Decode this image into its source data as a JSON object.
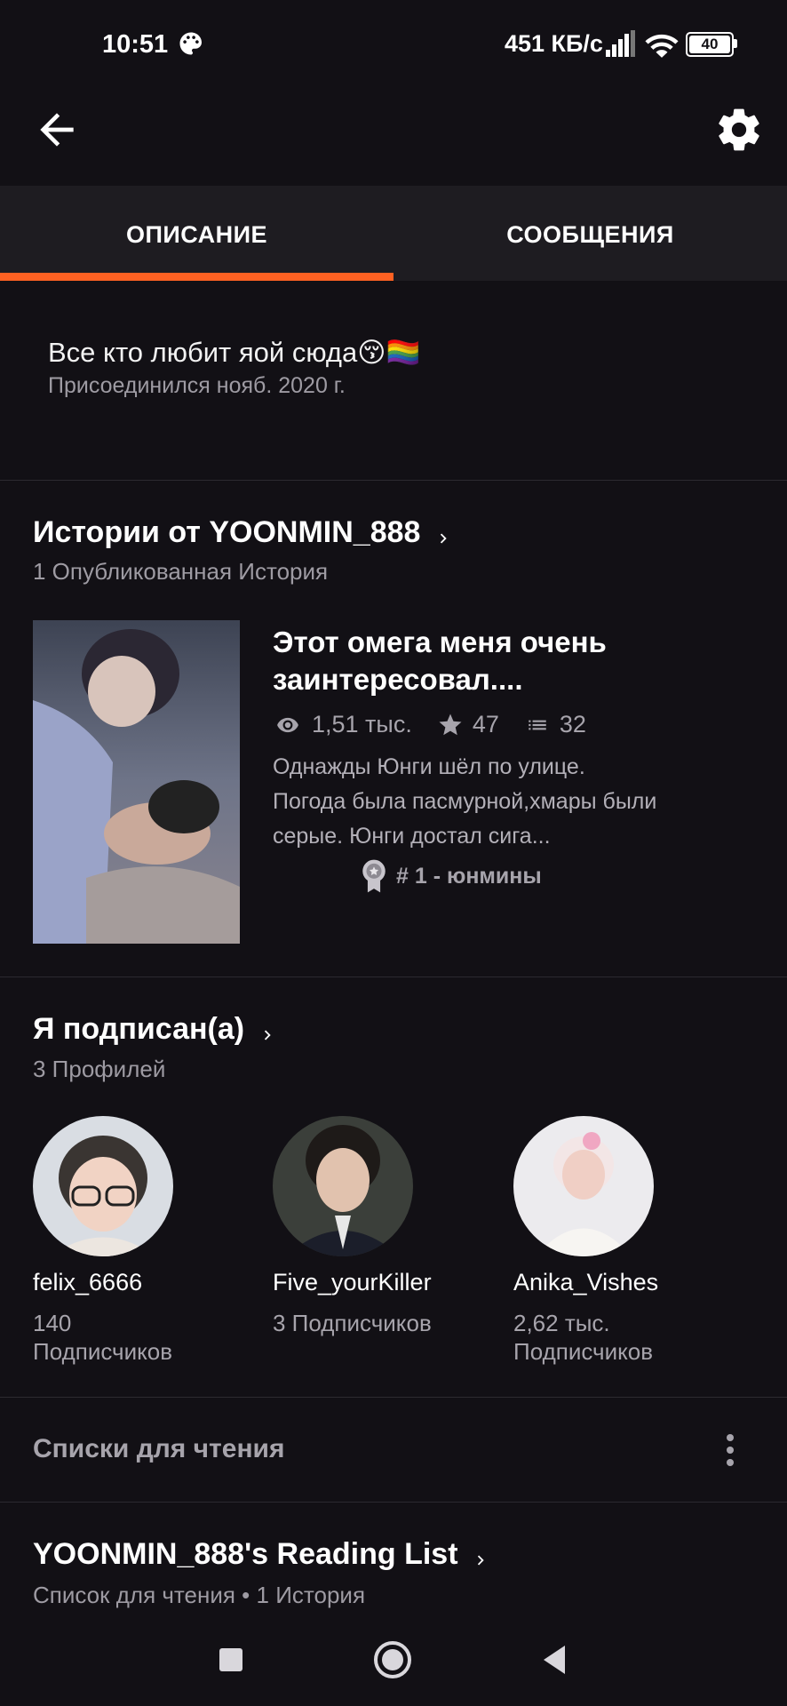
{
  "status_bar": {
    "time": "10:51",
    "net_speed": "451 КБ/с",
    "battery": "40"
  },
  "tabs": [
    {
      "label": "ОПИСАНИЕ",
      "active": true
    },
    {
      "label": "СООБЩЕНИЯ",
      "active": false
    }
  ],
  "accent_color": "#ff6122",
  "description": {
    "text": "Все кто любит яой сюда😚🏳️‍🌈",
    "joined": "Присоединился нояб. 2020 г."
  },
  "stories": {
    "title": "Истории от YOONMIN_888",
    "subtitle": "1 Опубликованная История",
    "items": [
      {
        "title": "Этот омега меня очень заинтересовал....",
        "reads": "1,51 тыс.",
        "votes": "47",
        "parts": "32",
        "blurb": "Однажды Юнги шёл по улице. Погода была пасмурной,хмары были серые. Юнги достал сига...",
        "badge": "# 1 - юнмины"
      }
    ]
  },
  "following": {
    "title": "Я подписан(а)",
    "subtitle": "3 Профилей",
    "profiles": [
      {
        "name": "felix_6666",
        "followers": "140 Подписчиков"
      },
      {
        "name": "Five_yourKiller",
        "followers": "3 Подписчиков"
      },
      {
        "name": "Anika_Vishes",
        "followers": "2,62 тыс. Подписчиков"
      }
    ]
  },
  "reading_lists": {
    "label": "Списки для чтения",
    "list_title": "YOONMIN_888's Reading List",
    "list_sub": "Список для чтения • 1 История"
  }
}
